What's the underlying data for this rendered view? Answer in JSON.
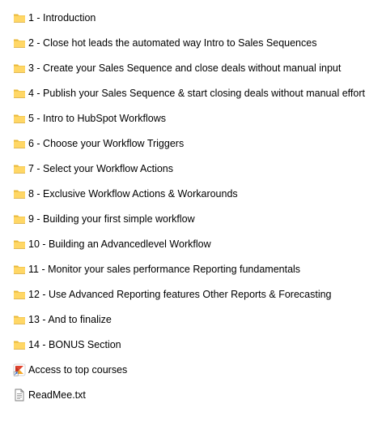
{
  "colors": {
    "folder_body": "#FFD766",
    "folder_tab": "#E8B83A",
    "folder_edge": "#D9A62E",
    "shortcut_red": "#E2452F",
    "shortcut_orange": "#F6A623",
    "doc_outline": "#7A7A7A"
  },
  "items": [
    {
      "label": "1 - Introduction",
      "icon": "folder-icon"
    },
    {
      "label": "2 - Close hot leads the automated way Intro to Sales Sequences",
      "icon": "folder-icon"
    },
    {
      "label": "3 - Create your Sales Sequence and close deals without manual input",
      "icon": "folder-icon"
    },
    {
      "label": "4 - Publish your Sales Sequence & start closing deals without manual effort",
      "icon": "folder-icon"
    },
    {
      "label": "5 - Intro to HubSpot Workflows",
      "icon": "folder-icon"
    },
    {
      "label": "6 - Choose your Workflow Triggers",
      "icon": "folder-icon"
    },
    {
      "label": "7 - Select your Workflow Actions",
      "icon": "folder-icon"
    },
    {
      "label": "8 - Exclusive Workflow Actions & Workarounds",
      "icon": "folder-icon"
    },
    {
      "label": "9 - Building your first simple workflow",
      "icon": "folder-icon"
    },
    {
      "label": "10 - Building an Advancedlevel Workflow",
      "icon": "folder-icon"
    },
    {
      "label": "11 - Monitor your sales performance Reporting fundamentals",
      "icon": "folder-icon"
    },
    {
      "label": "12 - Use Advanced Reporting features Other Reports & Forecasting",
      "icon": "folder-icon"
    },
    {
      "label": "13 - And to finalize",
      "icon": "folder-icon"
    },
    {
      "label": "14 - BONUS Section",
      "icon": "folder-icon"
    },
    {
      "label": "Access to top courses",
      "icon": "internet-shortcut-icon"
    },
    {
      "label": "ReadMee.txt",
      "icon": "text-document-icon"
    }
  ]
}
